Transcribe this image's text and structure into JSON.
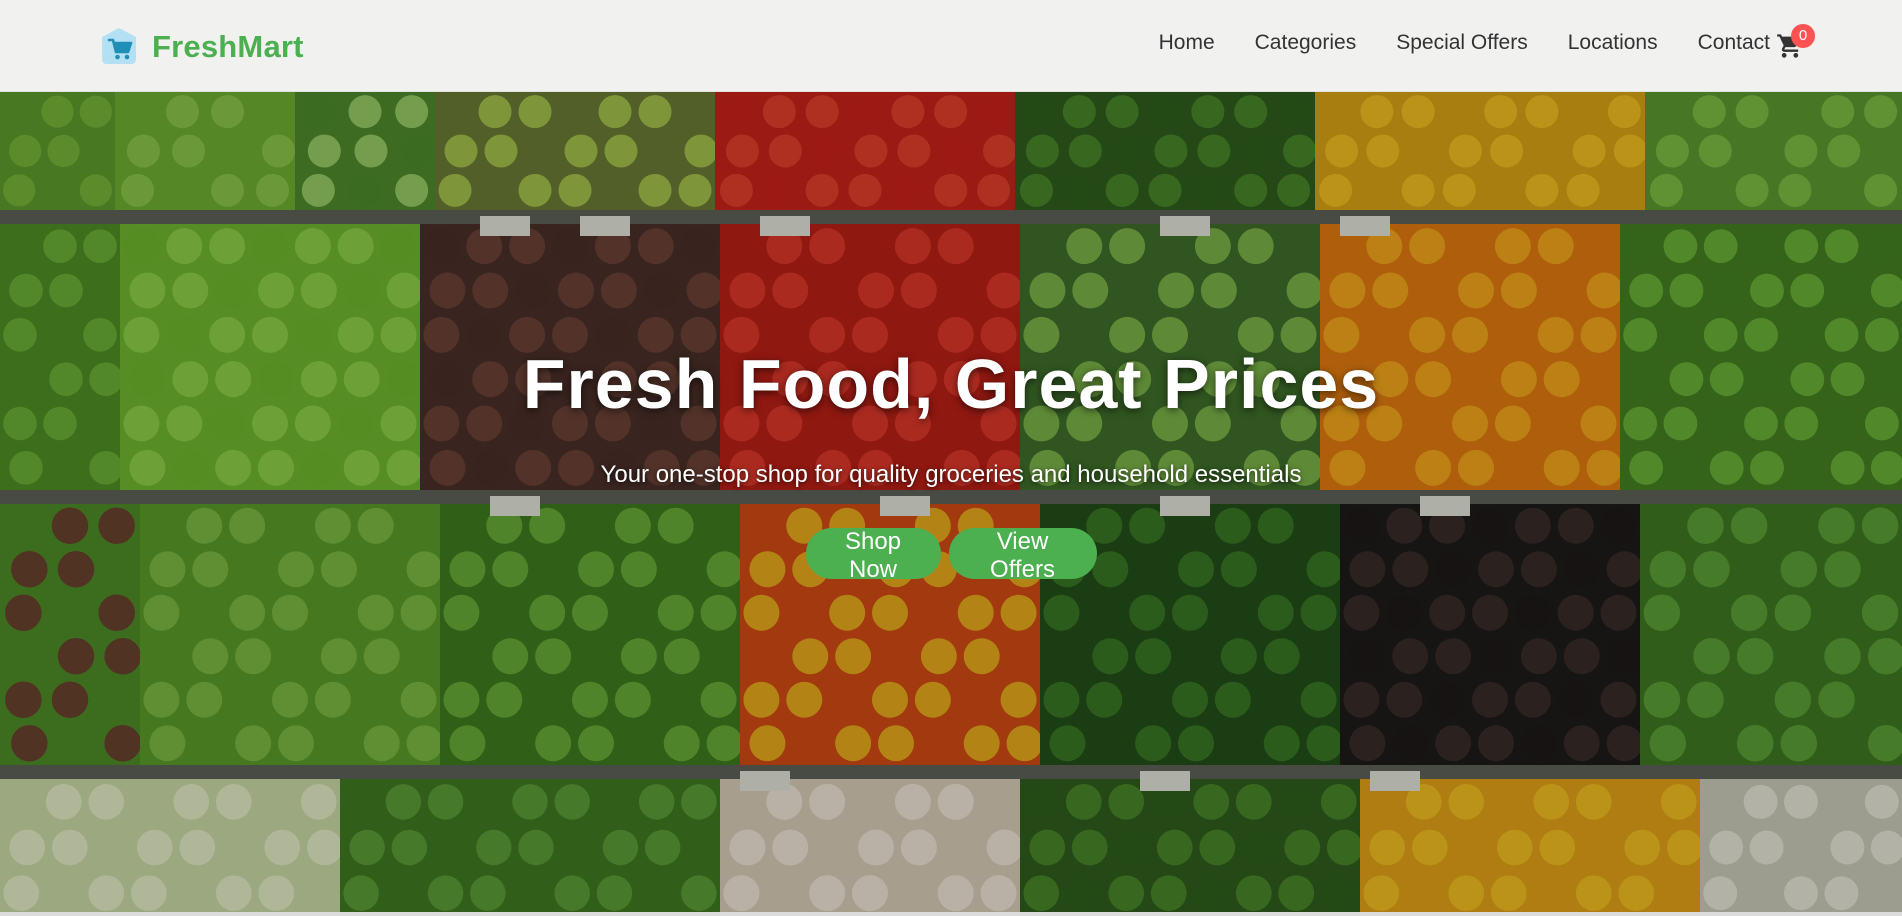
{
  "brand": {
    "name": "FreshMart",
    "logo_icon": "shopping-cart-icon",
    "color": "#4caf50"
  },
  "nav": {
    "items": [
      {
        "label": "Home"
      },
      {
        "label": "Categories"
      },
      {
        "label": "Special Offers"
      },
      {
        "label": "Locations"
      },
      {
        "label": "Contact"
      }
    ],
    "cart": {
      "icon": "cart-icon",
      "count": "0",
      "badge_color": "#ff5252"
    }
  },
  "hero": {
    "title": "Fresh Food, Great Prices",
    "subtitle": "Your one-stop shop for quality groceries and household essentials",
    "background": "fresh produce shelves",
    "buttons": {
      "shop_now": "Shop Now",
      "view_offers": "View Offers"
    },
    "button_color": "#4caf50"
  }
}
